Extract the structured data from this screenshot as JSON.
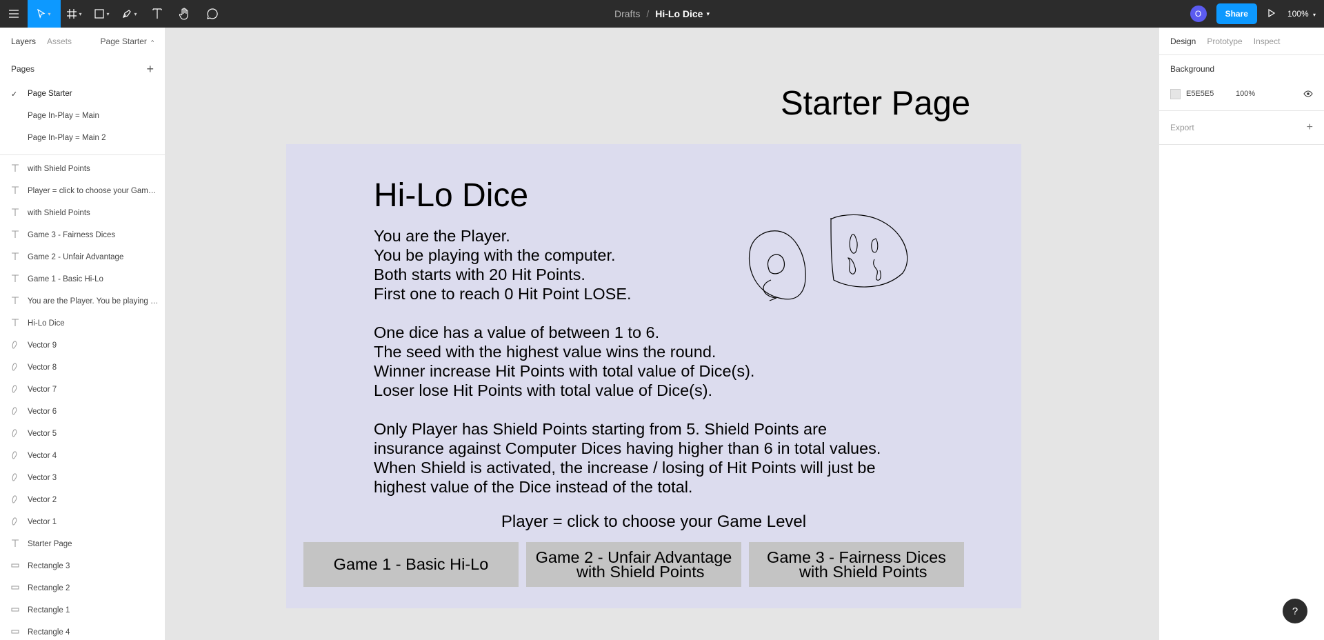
{
  "topbar": {
    "breadcrumb_parent": "Drafts",
    "breadcrumb_sep": "/",
    "file_name": "Hi-Lo Dice",
    "avatar_initial": "O",
    "share_label": "Share",
    "zoom": "100%"
  },
  "left_panel": {
    "tabs": [
      "Layers",
      "Assets"
    ],
    "page_selector": "Page Starter",
    "pages_label": "Pages",
    "pages": [
      {
        "name": "Page Starter",
        "current": true
      },
      {
        "name": "Page In-Play = Main",
        "current": false
      },
      {
        "name": "Page In-Play = Main 2",
        "current": false
      }
    ],
    "layers": [
      {
        "type": "text",
        "icon": "text-icon",
        "name": "with Shield Points"
      },
      {
        "type": "text",
        "icon": "text-icon",
        "name": "Player = click to choose your Game Level"
      },
      {
        "type": "text",
        "icon": "text-icon",
        "name": "with Shield Points"
      },
      {
        "type": "text",
        "icon": "text-icon",
        "name": "Game 3 - Fairness Dices"
      },
      {
        "type": "text",
        "icon": "text-icon",
        "name": "Game 2 - Unfair Advantage"
      },
      {
        "type": "text",
        "icon": "text-icon",
        "name": "Game 1 - Basic Hi-Lo"
      },
      {
        "type": "text",
        "icon": "text-icon",
        "name": "You are the Player. You be playing with the computer."
      },
      {
        "type": "text",
        "icon": "text-icon",
        "name": "Hi-Lo Dice"
      },
      {
        "type": "vector",
        "icon": "vector-icon",
        "name": "Vector 9"
      },
      {
        "type": "vector",
        "icon": "vector-icon",
        "name": "Vector 8"
      },
      {
        "type": "vector",
        "icon": "vector-icon",
        "name": "Vector 7"
      },
      {
        "type": "vector",
        "icon": "vector-icon",
        "name": "Vector 6"
      },
      {
        "type": "vector",
        "icon": "vector-icon",
        "name": "Vector 5"
      },
      {
        "type": "vector",
        "icon": "vector-icon",
        "name": "Vector 4"
      },
      {
        "type": "vector",
        "icon": "vector-icon",
        "name": "Vector 3"
      },
      {
        "type": "vector",
        "icon": "vector-icon",
        "name": "Vector 2"
      },
      {
        "type": "vector",
        "icon": "vector-icon",
        "name": "Vector 1"
      },
      {
        "type": "text",
        "icon": "text-icon",
        "name": "Starter Page"
      },
      {
        "type": "rect",
        "icon": "rectangle-icon",
        "name": "Rectangle 3"
      },
      {
        "type": "rect",
        "icon": "rectangle-icon",
        "name": "Rectangle 2"
      },
      {
        "type": "rect",
        "icon": "rectangle-icon",
        "name": "Rectangle 1"
      },
      {
        "type": "rect",
        "icon": "rectangle-icon",
        "name": "Rectangle 4"
      }
    ]
  },
  "canvas": {
    "page_title": "Starter Page",
    "game_title": "Hi-Lo Dice",
    "rules_text": "You are the Player.\nYou be playing with the computer.\nBoth starts with 20 Hit Points.\nFirst one to reach 0 Hit Point LOSE.\n\nOne dice has a value of between 1 to 6.\nThe seed with the highest value wins the round.\nWinner increase Hit Points with total value of Dice(s).\nLoser lose Hit Points with total value of Dice(s).\n\nOnly Player has Shield Points starting from 5. Shield Points are\ninsurance against Computer Dices having higher than 6 in total values.\nWhen Shield is activated, the increase / losing of Hit Points will just be\nhighest value of the Dice instead of the total.",
    "prompt": "Player = click to choose your Game Level",
    "buttons": [
      "Game 1 - Basic Hi-Lo",
      "Game 2 - Unfair Advantage\n   with Shield Points",
      "Game 3 - Fairness Dices\n   with Shield Points"
    ]
  },
  "right_panel": {
    "tabs": [
      "Design",
      "Prototype",
      "Inspect"
    ],
    "background_label": "Background",
    "bg_hex": "E5E5E5",
    "bg_opacity": "100%",
    "export_label": "Export"
  },
  "colors": {
    "accent": "#0d99ff",
    "toolbar": "#2c2c2c",
    "frame": "#dcdcee",
    "button": "#c4c4c4",
    "canvas": "#e5e5e5"
  }
}
